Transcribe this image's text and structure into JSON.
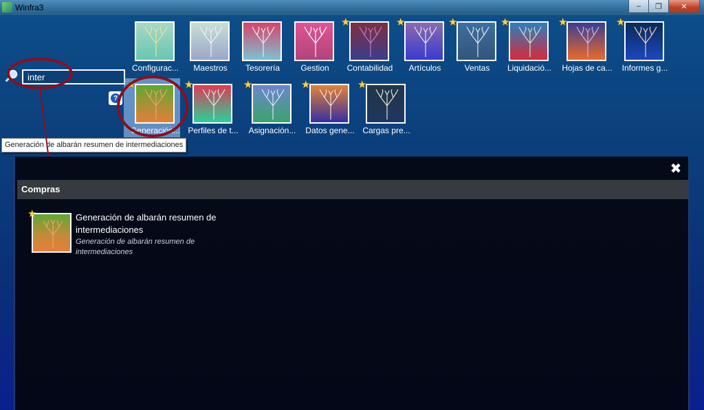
{
  "window": {
    "title": "Winfra3",
    "minimize_label": "‒",
    "maximize_label": "❐",
    "close_label": "✕"
  },
  "search": {
    "value": "inter",
    "help_label": "?"
  },
  "tiles_row1": [
    {
      "label": "Configurac...",
      "star": false,
      "colors": [
        "#a9d7c7",
        "#67c7b0"
      ],
      "tree": "#e6e3a0"
    },
    {
      "label": "Maestros",
      "star": false,
      "colors": [
        "#c8e0d6",
        "#9aa7c8"
      ],
      "tree": "#f2f0f3"
    },
    {
      "label": "Tesorería",
      "star": false,
      "colors": [
        "#d7436a",
        "#7bc3d2"
      ],
      "tree": "#f3e4ea"
    },
    {
      "label": "Gestion",
      "star": false,
      "colors": [
        "#e05493",
        "#b2447b"
      ],
      "tree": "#ffffff"
    },
    {
      "label": "Contabilidad",
      "star": true,
      "colors": [
        "#7e2f3e",
        "#3c3d8c"
      ],
      "tree": "#b978c7"
    },
    {
      "label": "Artículos",
      "star": true,
      "colors": [
        "#8a6bb0",
        "#3a3ad0"
      ],
      "tree": "#e2e6e2"
    },
    {
      "label": "Ventas",
      "star": true,
      "colors": [
        "#3e6fa0",
        "#31557c"
      ],
      "tree": "#dfe3ea"
    },
    {
      "label": "Liquidació...",
      "star": true,
      "colors": [
        "#2c7fbe",
        "#d82a3b"
      ],
      "tree": "#bfe5cf"
    },
    {
      "label": "Hojas de ca...",
      "star": true,
      "colors": [
        "#3a3d8f",
        "#eb6a2a"
      ],
      "tree": "#b7b6ff"
    },
    {
      "label": "Informes g...",
      "star": true,
      "colors": [
        "#0a2a57",
        "#1b47c0"
      ],
      "tree": "#f3d0b0"
    }
  ],
  "tiles_row2": [
    {
      "label": "Generación...",
      "star": true,
      "selected": true,
      "colors": [
        "#5ea832",
        "#e67e39"
      ],
      "tree": "#f0a070"
    },
    {
      "label": "Perfiles de t...",
      "star": true,
      "selected": false,
      "colors": [
        "#e03a54",
        "#27d29a"
      ],
      "tree": "#d2e6e0"
    },
    {
      "label": "Asignación...",
      "star": true,
      "selected": false,
      "colors": [
        "#6e84d0",
        "#3aa46b"
      ],
      "tree": "#e0e0ff"
    },
    {
      "label": "Datos gene...",
      "star": true,
      "selected": false,
      "colors": [
        "#e28438",
        "#362ea1"
      ],
      "tree": "#f3ddc0"
    },
    {
      "label": "Cargas pre...",
      "star": true,
      "selected": false,
      "colors": [
        "#20364a",
        "#1f3760"
      ],
      "tree": "#e9e2c6"
    }
  ],
  "tooltip": "Generación de albarán resumen de intermediaciones",
  "panel": {
    "close_label": "✖",
    "section": "Compras",
    "result": {
      "title": "Generación de albarán resumen de intermediaciones",
      "description": "Generación de albarán resumen de intermediaciones"
    }
  },
  "colors": {
    "annotation": "#8a0f1f",
    "star": "#f6d04d",
    "panel_background": "#040717",
    "section_header": "#373a3f"
  }
}
